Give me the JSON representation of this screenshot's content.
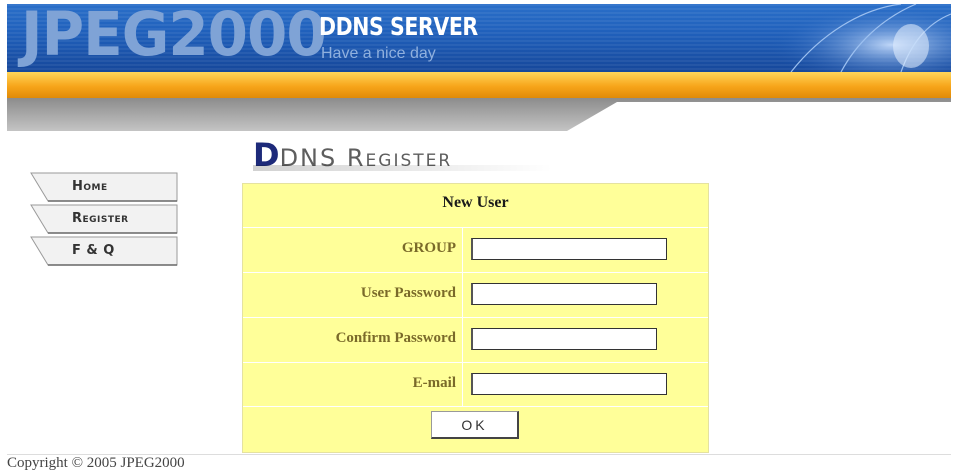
{
  "header": {
    "logo": "JPEG2000",
    "title": "DDNS SERVER",
    "subtitle": "Have a nice day"
  },
  "heading": {
    "first_letter": "D",
    "rest": "DNS Register"
  },
  "nav": {
    "items": [
      {
        "label": "Home"
      },
      {
        "label": "Register"
      },
      {
        "label": "F & Q"
      }
    ]
  },
  "form": {
    "caption": "New User",
    "fields": [
      {
        "label": "GROUP",
        "value": ""
      },
      {
        "label": "User Password",
        "value": ""
      },
      {
        "label": "Confirm Password",
        "value": ""
      },
      {
        "label": "E-mail",
        "value": ""
      }
    ],
    "submit_label": "OK"
  },
  "footer": {
    "copyright": "Copyright © 2005 JPEG2000"
  },
  "colors": {
    "banner_blue": "#1f5fba",
    "orange_bar": "#f7a51a",
    "form_background": "#ffff99"
  }
}
